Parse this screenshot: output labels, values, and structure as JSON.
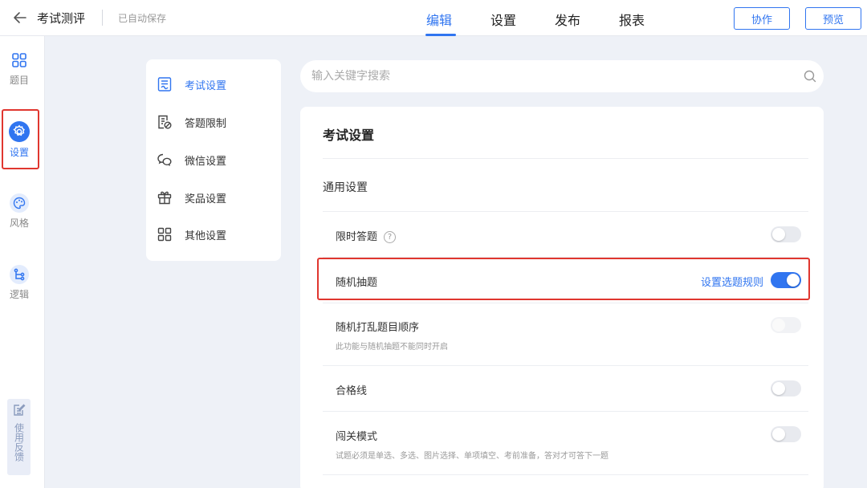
{
  "header": {
    "title": "考试测评",
    "autosave": "已自动保存",
    "tabs": [
      {
        "label": "编辑",
        "active": true
      },
      {
        "label": "设置",
        "active": false
      },
      {
        "label": "发布",
        "active": false
      },
      {
        "label": "报表",
        "active": false
      }
    ],
    "collaborate_label": "协作",
    "preview_label": "预览"
  },
  "rail": {
    "items": [
      {
        "label": "题目",
        "icon": "grid-icon",
        "active": false
      },
      {
        "label": "设置",
        "icon": "gear-icon",
        "active": true
      },
      {
        "label": "风格",
        "icon": "palette-icon",
        "active": false
      },
      {
        "label": "逻辑",
        "icon": "branch-icon",
        "active": false
      }
    ],
    "feedback_label": "使用反馈"
  },
  "settings_menu": {
    "items": [
      {
        "label": "考试设置",
        "icon": "exam-doc-icon",
        "active": true
      },
      {
        "label": "答题限制",
        "icon": "answer-limit-icon",
        "active": false
      },
      {
        "label": "微信设置",
        "icon": "wechat-icon",
        "active": false
      },
      {
        "label": "奖品设置",
        "icon": "gift-icon",
        "active": false
      },
      {
        "label": "其他设置",
        "icon": "apps-icon",
        "active": false
      }
    ]
  },
  "search": {
    "placeholder": "输入关键字搜索"
  },
  "panel": {
    "title": "考试设置",
    "section": "通用设置",
    "rows": [
      {
        "label": "限时答题",
        "toggle": false,
        "has_help": true
      },
      {
        "label": "随机抽题",
        "toggle": true,
        "link": "设置选题规则"
      },
      {
        "label": "随机打乱题目顺序",
        "toggle": false,
        "disabled": true,
        "desc": "此功能与随机抽题不能同时开启"
      },
      {
        "label": "合格线",
        "toggle": false
      },
      {
        "label": "闯关模式",
        "toggle": false,
        "desc": "试题必须是单选、多选、图片选择、单项填空、考前准备，答对才可答下一题"
      }
    ]
  },
  "colors": {
    "accent": "#3075f0",
    "highlight": "#e0362f"
  }
}
